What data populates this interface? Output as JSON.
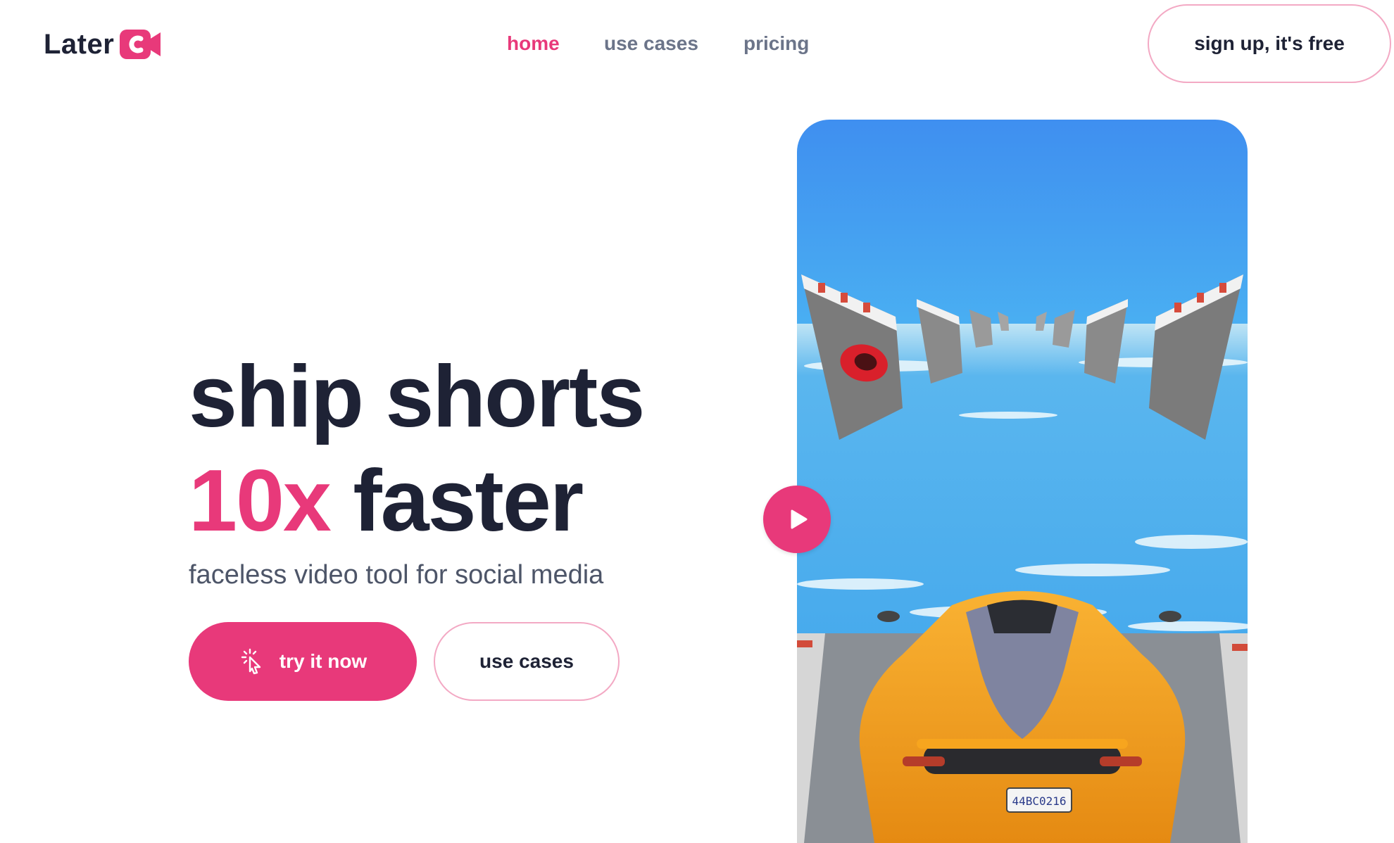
{
  "brand": {
    "name": "Later",
    "accent_color": "#e8397a",
    "text_color": "#1e2235"
  },
  "nav": {
    "items": [
      {
        "label": "home",
        "active": true
      },
      {
        "label": "use cases",
        "active": false
      },
      {
        "label": "pricing",
        "active": false
      }
    ]
  },
  "header": {
    "signup_label": "sign up, it's free"
  },
  "hero": {
    "headline_line1": "ship shorts",
    "headline_accent": "10x",
    "headline_line2_rest": " faster",
    "subline": "faceless video tool for social media",
    "primary_cta": "try it now",
    "primary_cta_icon": "cursor-click-icon",
    "secondary_cta": "use cases"
  },
  "video": {
    "play_icon": "play-icon",
    "license_plate": "44BC0216"
  }
}
